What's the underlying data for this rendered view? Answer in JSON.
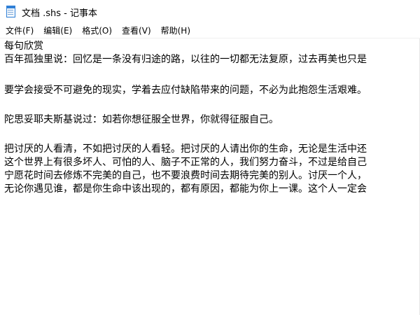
{
  "window": {
    "title": "文档 .shs - 记事本"
  },
  "menu": {
    "items": [
      {
        "label": "文件(F)"
      },
      {
        "label": "编辑(E)"
      },
      {
        "label": "格式(O)"
      },
      {
        "label": "查看(V)"
      },
      {
        "label": "帮助(H)"
      }
    ]
  },
  "editor": {
    "lines": [
      "每句欣赏",
      "百年孤独里说：回忆是一条没有归途的路，以往的一切都无法复原，过去再美也只是",
      "要学会接受不可避免的现实，学着去应付缺陷带来的问题，不必为此抱怨生活艰难。",
      "陀思妥耶夫斯基说过：如若你想征服全世界，你就得征服自己。",
      "把讨厌的人看清，不如把讨厌的人看轻。把讨厌的人请出你的生命，无论是生活中还",
      "这个世界上有很多坏人、可怕的人、脑子不正常的人，我们努力奋斗，不过是给自己",
      "宁愿花时间去修炼不完美的自己，也不要浪费时间去期待完美的别人。讨厌一个人，",
      "无论你遇见谁，都是你生命中该出现的，都有原因，都能为你上一课。这个人一定会"
    ]
  }
}
